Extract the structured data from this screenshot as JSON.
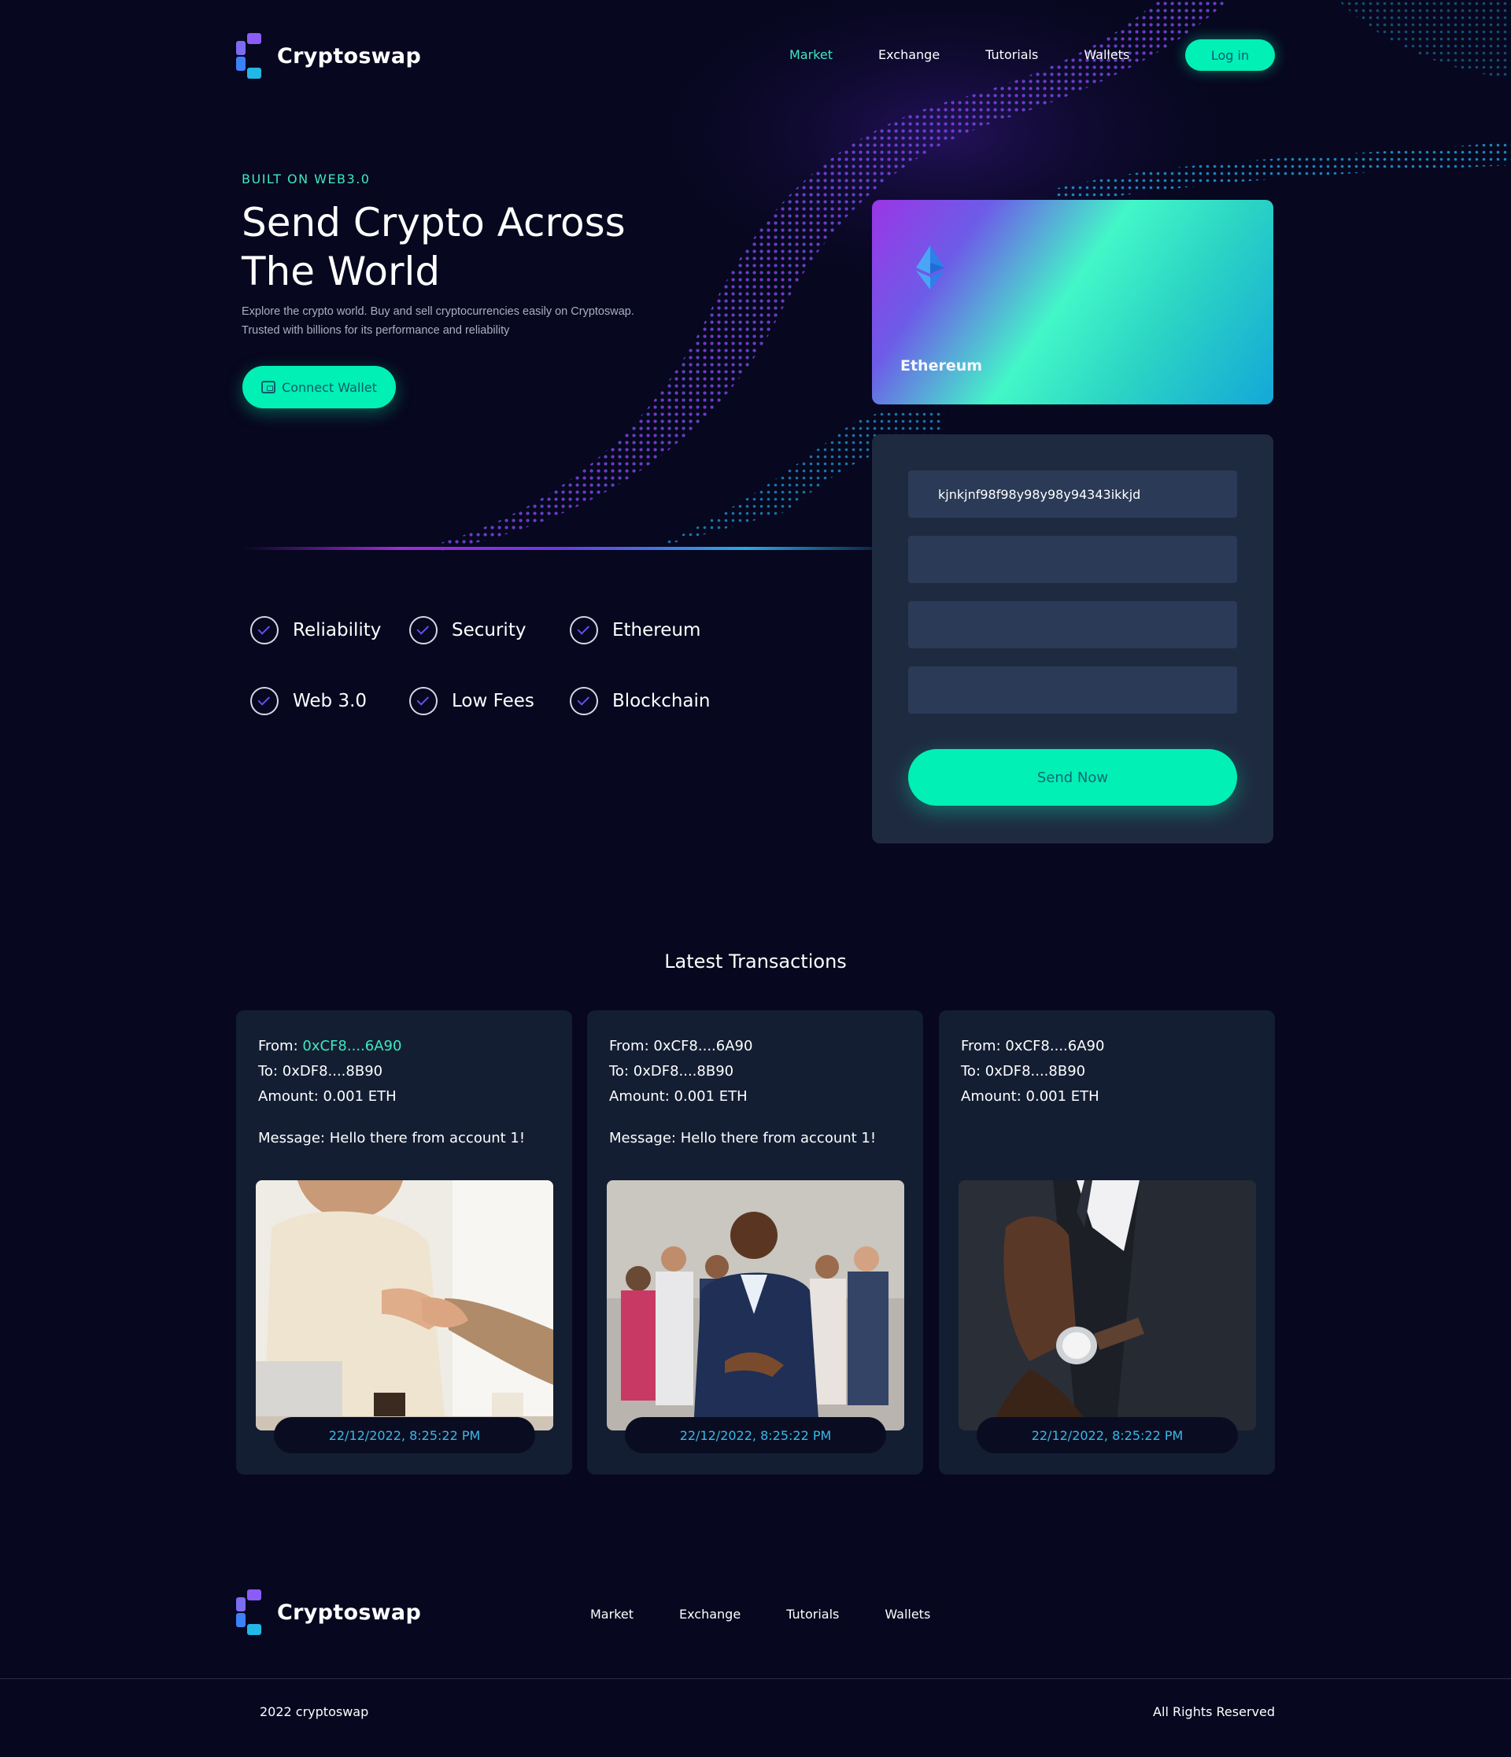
{
  "brand": {
    "name": "Cryptoswap"
  },
  "nav": {
    "links": [
      "Market",
      "Exchange",
      "Tutorials",
      "Wallets"
    ],
    "active": "Market",
    "login_label": "Log in"
  },
  "hero": {
    "eyebrow": "BUILT ON WEB3.0",
    "title_line1": "Send Crypto Across",
    "title_line2": "The World",
    "description": "Explore the crypto world. Buy and sell cryptocurrencies easily on Cryptoswap. Trusted with billions for its performance and reliability",
    "connect_label": "Connect Wallet"
  },
  "features": [
    "Reliability",
    "Security",
    "Ethereum",
    "Web 3.0",
    "Low Fees",
    "Blockchain"
  ],
  "card": {
    "label": "Ethereum",
    "icon": "ethereum-icon"
  },
  "form": {
    "address_value": "kjnkjnf98f98y98y98y94343ikkjd",
    "send_label": "Send Now"
  },
  "transactions": {
    "title": "Latest Transactions",
    "items": [
      {
        "from_label": "From:",
        "from": "0xCF8....6A90",
        "to_label": "To:",
        "to": "0xDF8....8B90",
        "amount_label": "Amount:",
        "amount": "0.001 ETH",
        "message_label": "Message:",
        "message": "Hello there from account 1!",
        "timestamp": "22/12/2022, 8:25:22 PM",
        "image": "handshake-photo"
      },
      {
        "from_label": "From:",
        "from": "0xCF8....6A90",
        "to_label": "To:",
        "to": "0xDF8....8B90",
        "amount_label": "Amount:",
        "amount": "0.001 ETH",
        "message_label": "Message:",
        "message": "Hello there from account 1!",
        "timestamp": "22/12/2022, 8:25:22 PM",
        "image": "team-photo"
      },
      {
        "from_label": "From:",
        "from": "0xCF8....6A90",
        "to_label": "To:",
        "to": "0xDF8....8B90",
        "amount_label": "Amount:",
        "amount": "0.001 ETH",
        "message_label": "",
        "message": "",
        "timestamp": "22/12/2022, 8:25:22 PM",
        "image": "watch-suit-photo"
      }
    ]
  },
  "footer": {
    "links": [
      "Market",
      "Exchange",
      "Tutorials",
      "Wallets"
    ],
    "copyright": "2022 cryptoswap",
    "rights": "All Rights Reserved"
  },
  "colors": {
    "background": "#07071f",
    "accent": "#00f0b5",
    "accent_text": "#3ee8c2",
    "panel": "#1e2a40",
    "input": "#2b3b57",
    "card": "#131e33",
    "timestamp": "#3ab8e8"
  }
}
